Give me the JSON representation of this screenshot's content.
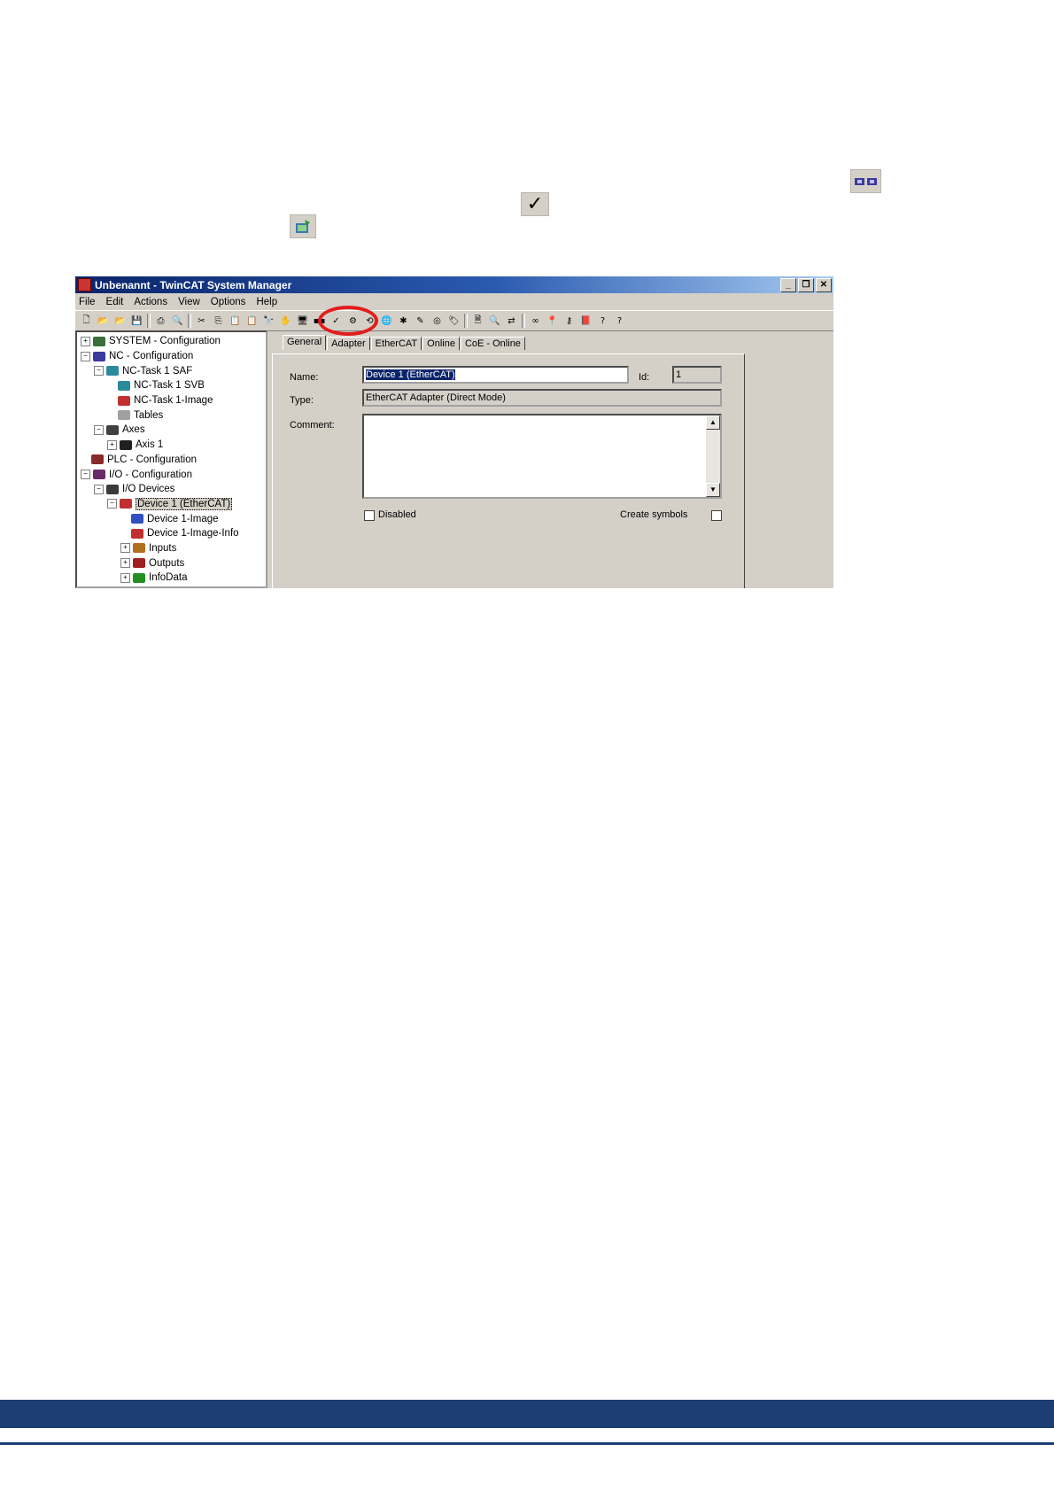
{
  "window": {
    "title": "Unbenannt - TwinCAT System Manager",
    "controls": {
      "minimize": "_",
      "restore": "❐",
      "close": "✕"
    }
  },
  "menu": [
    "File",
    "Edit",
    "Actions",
    "View",
    "Options",
    "Help"
  ],
  "tree": [
    {
      "label": "SYSTEM - Configuration",
      "level": 0,
      "expander": "+",
      "color": "#3a6e3a"
    },
    {
      "label": "NC - Configuration",
      "level": 0,
      "expander": "−",
      "color": "#3a3a9a"
    },
    {
      "label": "NC-Task 1 SAF",
      "level": 1,
      "expander": "−",
      "color": "#2a8a9a"
    },
    {
      "label": "NC-Task 1 SVB",
      "level": 2,
      "expander": "",
      "color": "#2a8a9a"
    },
    {
      "label": "NC-Task 1-Image",
      "level": 2,
      "expander": "",
      "color": "#c03030"
    },
    {
      "label": "Tables",
      "level": 2,
      "expander": "",
      "color": "#a0a0a0"
    },
    {
      "label": "Axes",
      "level": 1,
      "expander": "−",
      "color": "#404040"
    },
    {
      "label": "Axis 1",
      "level": 2,
      "expander": "+",
      "color": "#202020"
    },
    {
      "label": "PLC - Configuration",
      "level": 0,
      "expander": "",
      "color": "#8a2a2a"
    },
    {
      "label": "I/O - Configuration",
      "level": 0,
      "expander": "−",
      "color": "#6a2a6a"
    },
    {
      "label": "I/O Devices",
      "level": 1,
      "expander": "−",
      "color": "#3a3a3a"
    },
    {
      "label": "Device 1 (EtherCAT)",
      "level": 2,
      "expander": "−",
      "color": "#c03030",
      "selected": true
    },
    {
      "label": "Device 1-Image",
      "level": 3,
      "expander": "",
      "color": "#3050c0"
    },
    {
      "label": "Device 1-Image-Info",
      "level": 3,
      "expander": "",
      "color": "#c03030"
    },
    {
      "label": "Inputs",
      "level": 3,
      "expander": "+",
      "color": "#b07020"
    },
    {
      "label": "Outputs",
      "level": 3,
      "expander": "+",
      "color": "#a02020"
    },
    {
      "label": "InfoData",
      "level": 3,
      "expander": "+",
      "color": "#209020"
    }
  ],
  "tabs": [
    "General",
    "Adapter",
    "EtherCAT",
    "Online",
    "CoE - Online"
  ],
  "form": {
    "name_label": "Name:",
    "name_value": "Device 1 (EtherCAT)",
    "id_label": "Id:",
    "id_value": "1",
    "type_label": "Type:",
    "type_value": "EtherCAT Adapter (Direct Mode)",
    "comment_label": "Comment:",
    "comment_value": "",
    "disabled_label": "Disabled",
    "create_symbols_label": "Create symbols"
  },
  "inline_icons": {
    "config_mode": "config-mode-icon",
    "check": "✓",
    "activate": "activate-configuration-icon"
  },
  "colors": {
    "footer": "#1d3e72",
    "highlight": "#e31c1c",
    "titlebar": "#0a246a"
  }
}
